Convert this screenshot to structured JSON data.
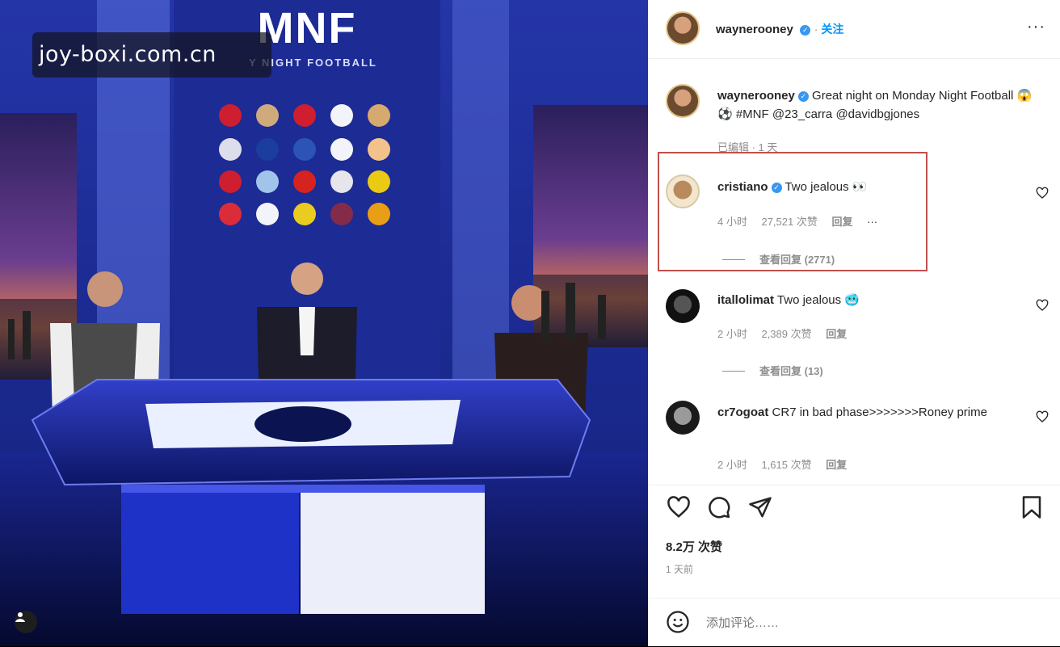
{
  "watermark": "joy-boxi.com.cn",
  "photo": {
    "logo": "MNF",
    "logo_sub": "Y NIGHT FOOTBALL"
  },
  "post": {
    "author": "waynerooney",
    "follow_label": "关注",
    "more_icon": "more-horizontal-icon",
    "caption_author": "waynerooney",
    "caption_text": "Great night on Monday Night Football 😱⚽ #MNF @23_carra @davidbgjones",
    "caption_meta": "已编辑 · 1 天"
  },
  "comments": [
    {
      "user": "cristiano",
      "verified": true,
      "text": "Two jealous 👀",
      "time": "4 小时",
      "likes": "27,521 次赞",
      "reply": "回复",
      "more": "···",
      "view_replies": "查看回复 (2771)"
    },
    {
      "user": "itallolimat",
      "verified": false,
      "text": "Two jealous 🥶",
      "time": "2 小时",
      "likes": "2,389 次赞",
      "reply": "回复",
      "view_replies": "查看回复 (13)"
    },
    {
      "user": "cr7ogoat",
      "verified": false,
      "text": "CR7 in bad phase>>>>>>>Roney prime",
      "time": "2 小时",
      "likes": "1,615 次赞",
      "reply": "回复"
    }
  ],
  "stats": {
    "likes": "8.2万 次赞",
    "time": "1 天前"
  },
  "add_comment": {
    "placeholder": "添加评论……"
  }
}
